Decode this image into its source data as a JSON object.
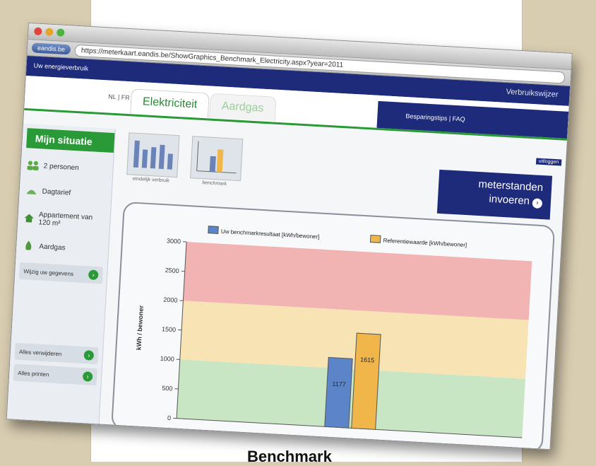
{
  "caption": "Benchmark",
  "browser": {
    "site_badge": "eandis.be",
    "url": "https://meterkaart.eandis.be/ShowGraphics_Benchmark_Electricity.aspx?year=2011"
  },
  "header": {
    "left": "Uw energieverbruik",
    "right": "Verbruikswijzer"
  },
  "lang": "NL | FR",
  "tabs": [
    {
      "label": "Elektriciteit"
    },
    {
      "label": "Aardgas"
    }
  ],
  "tips": "Besparingstips | FAQ",
  "logout": "uitloggen",
  "meter_button": {
    "line1": "meterstanden",
    "line2": "invoeren"
  },
  "sidebar": {
    "title": "Mijn situatie",
    "items": [
      {
        "label": "2 personen",
        "icon": "people-icon"
      },
      {
        "label": "Dagtarief",
        "icon": "meter-icon"
      },
      {
        "label": "Appartement van 120 m²",
        "icon": "house-icon"
      },
      {
        "label": "Aardgas",
        "icon": "flame-icon"
      }
    ],
    "change": "Wijzig uw gegevens",
    "remove_all": "Alles verwijderen",
    "print_all": "Alles printen"
  },
  "thumbs": [
    {
      "label": "eindelijk verbruik"
    },
    {
      "label": "benchmark"
    }
  ],
  "chart_data": {
    "type": "bar",
    "ylabel": "kWh / bewoner",
    "ylim": [
      0,
      3000
    ],
    "yticks": [
      0,
      500,
      1000,
      1500,
      2000,
      2500,
      3000
    ],
    "bands": [
      {
        "from": 0,
        "to": 1000,
        "color": "#c9e6c4"
      },
      {
        "from": 1000,
        "to": 2000,
        "color": "#f8e3b4"
      },
      {
        "from": 2000,
        "to": 3000,
        "color": "#f2b3b3"
      }
    ],
    "series": [
      {
        "name": "Uw benchmarkresultaat [kWh/bewoner]",
        "value": 1177,
        "color": "#5b84c9",
        "label": "1177"
      },
      {
        "name": "Referentiewaarde [kWh/bewoner]",
        "value": 1615,
        "color": "#f0b64a",
        "label": "1615"
      }
    ]
  }
}
